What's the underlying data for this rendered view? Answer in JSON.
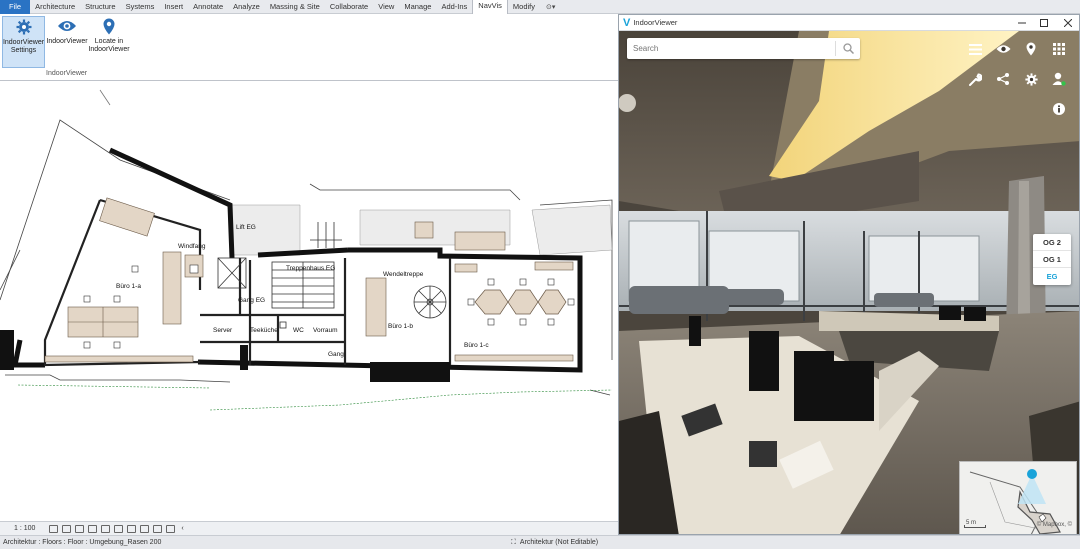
{
  "ribbon": {
    "tabs": [
      "File",
      "Architecture",
      "Structure",
      "Systems",
      "Insert",
      "Annotate",
      "Analyze",
      "Massing & Site",
      "Collaborate",
      "View",
      "Manage",
      "Add-Ins",
      "NavVis",
      "Modify"
    ],
    "active_tab": "NavVis",
    "extra": "⊙▾",
    "buttons": [
      {
        "line1": "IndoorViewer",
        "line2": "Settings",
        "icon": "gear-icon",
        "selected": true
      },
      {
        "line1": "IndoorViewer",
        "line2": "",
        "icon": "eye-icon",
        "selected": false
      },
      {
        "line1": "Locate in",
        "line2": "IndoorViewer",
        "icon": "location-pin-icon",
        "selected": false
      }
    ],
    "panel_label": "IndoorViewer"
  },
  "floorplan": {
    "rooms": [
      "Büro 1-a",
      "Windfang",
      "Lift EG",
      "Treppenhaus EG",
      "Gang EG",
      "Server",
      "Teeküche",
      "WC",
      "Vorraum",
      "Gang",
      "Wendeltreppe",
      "Büro 1-b",
      "Büro 1-c"
    ]
  },
  "view_status": {
    "scale": "1 : 100"
  },
  "status": {
    "left": "Architektur : Floors : Floor : Umgebung_Rasen 200",
    "workset": "Architektur (Not Editable)"
  },
  "iv": {
    "title": "IndoorViewer",
    "logo": "V",
    "search_placeholder": "Search",
    "floors": [
      "OG 2",
      "OG 1",
      "EG"
    ],
    "active_floor": "EG",
    "minimap": {
      "scale": "5 m",
      "attribution": "© Mapbox, ©"
    },
    "colors": {
      "accent": "#1aa3d9",
      "status_green": "#34c24a"
    }
  }
}
